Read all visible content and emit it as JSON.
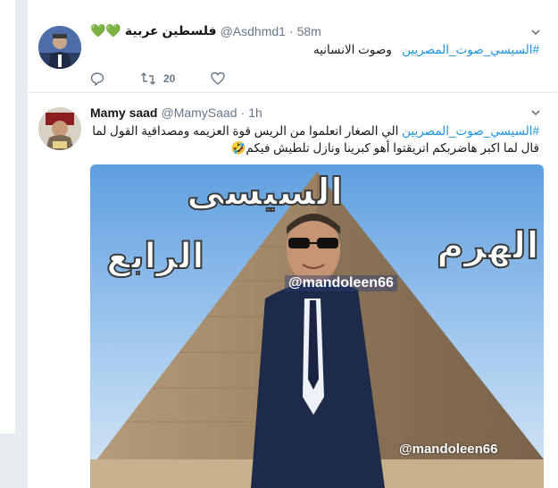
{
  "tweets": [
    {
      "author_name": "فلسطين عربية",
      "hearts": "💚💚",
      "handle": "@Asdhmd1",
      "time": "58m",
      "hashtag": "#السيسي_صوت_المصريين",
      "body": "وصوت الانسانيه",
      "reply_count": "",
      "retweet_count": "20",
      "like_count": ""
    },
    {
      "author_name": "Mamy saad",
      "handle": "@MamySaad",
      "time": "1h",
      "hashtag": "#السيسي_صوت_المصريين",
      "body": "الي الصغار اتعلموا من الريس قوة العزيمه ومصداقية القول لما قال لما اكبر هاضربكم اتريقتوا أهو كبرينا ونازل تلطيش فيكم🤣",
      "image": {
        "title_left": "الرابع",
        "title_top": "السيسى",
        "title_right": "الهرم",
        "watermark_1": "@mandoleen66",
        "watermark_2": "@mandoleen66"
      }
    }
  ],
  "colors": {
    "link": "#1b95e0",
    "muted": "#657786",
    "heart_green": "#63a52a"
  },
  "icons": [
    "reply-icon",
    "retweet-icon",
    "like-icon",
    "chevron-down-icon"
  ]
}
